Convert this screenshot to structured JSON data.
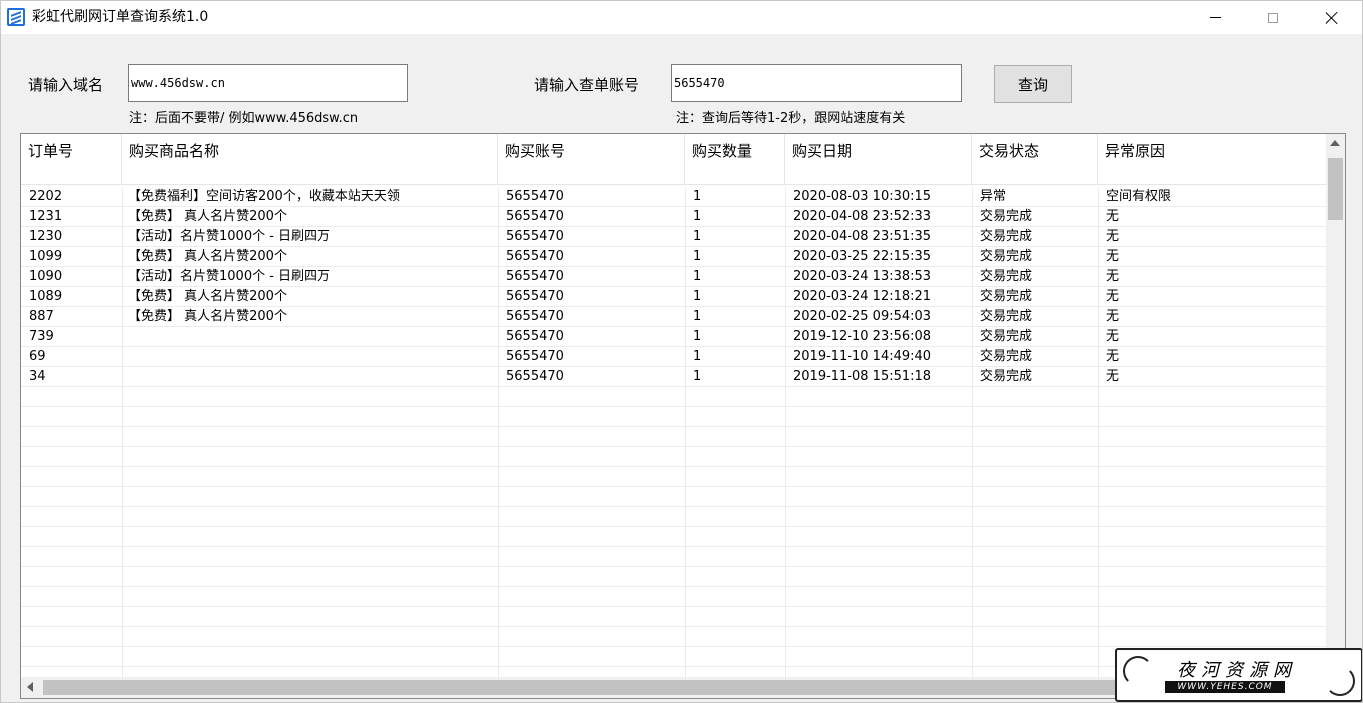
{
  "window": {
    "title": "彩虹代刷网订单查询系统1.0",
    "icon": "app-logo-icon"
  },
  "form": {
    "domain_label": "请输入域名",
    "domain_value": "www.456dsw.cn",
    "domain_note": "注：后面不要带/ 例如www.456dsw.cn",
    "account_label": "请输入查单账号",
    "account_value": "5655470",
    "account_note": "注：查询后等待1-2秒，跟网站速度有关",
    "query_button": "查询"
  },
  "table": {
    "columns": [
      "订单号",
      "购买商品名称",
      "购买账号",
      "购买数量",
      "购买日期",
      "交易状态",
      "异常原因"
    ],
    "rows": [
      [
        "2202",
        "【免费福利】空间访客200个，收藏本站天天领",
        "5655470",
        "1",
        "2020-08-03 10:30:15",
        "异常",
        "空间有权限"
      ],
      [
        "1231",
        "【免费】 真人名片赞200个",
        "5655470",
        "1",
        "2020-04-08 23:52:33",
        "交易完成",
        "无"
      ],
      [
        "1230",
        "【活动】名片赞1000个 - 日刷四万",
        "5655470",
        "1",
        "2020-04-08 23:51:35",
        "交易完成",
        "无"
      ],
      [
        "1099",
        "【免费】 真人名片赞200个",
        "5655470",
        "1",
        "2020-03-25 22:15:35",
        "交易完成",
        "无"
      ],
      [
        "1090",
        "【活动】名片赞1000个 - 日刷四万",
        "5655470",
        "1",
        "2020-03-24 13:38:53",
        "交易完成",
        "无"
      ],
      [
        "1089",
        "【免费】 真人名片赞200个",
        "5655470",
        "1",
        "2020-03-24 12:18:21",
        "交易完成",
        "无"
      ],
      [
        "887",
        "【免费】 真人名片赞200个",
        "5655470",
        "1",
        "2020-02-25 09:54:03",
        "交易完成",
        "无"
      ],
      [
        "739",
        "",
        "5655470",
        "1",
        "2019-12-10 23:56:08",
        "交易完成",
        "无"
      ],
      [
        "69",
        "",
        "5655470",
        "1",
        "2019-11-10 14:49:40",
        "交易完成",
        "无"
      ],
      [
        "34",
        "",
        "5655470",
        "1",
        "2019-11-08 15:51:18",
        "交易完成",
        "无"
      ]
    ]
  },
  "watermark": {
    "main": "夜河资源网",
    "sub": "WWW.YEHES.COM"
  }
}
